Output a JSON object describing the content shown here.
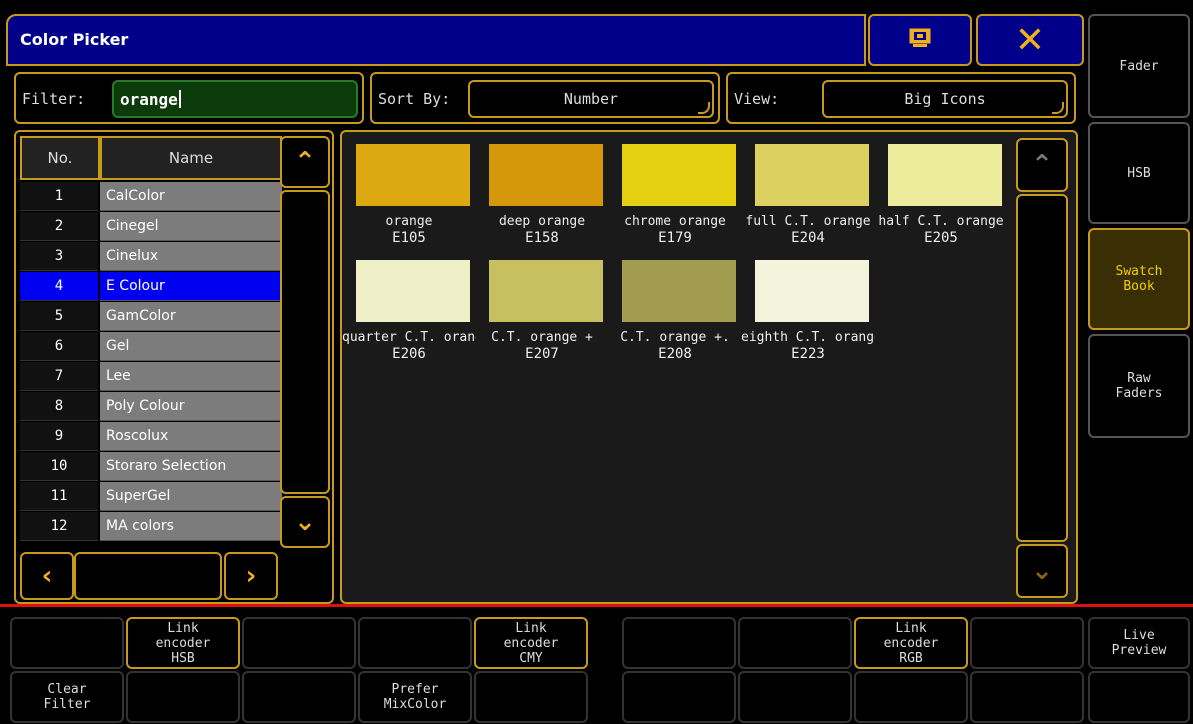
{
  "window": {
    "title": "Color Picker"
  },
  "header": {
    "screen_icon": "screen-icon",
    "close_icon": "close-icon"
  },
  "filter": {
    "label": "Filter:",
    "value": "orange"
  },
  "sort": {
    "label": "Sort By:",
    "value": "Number"
  },
  "view": {
    "label": "View:",
    "value": "Big Icons"
  },
  "list": {
    "headers": {
      "no": "No.",
      "name": "Name"
    },
    "rows": [
      {
        "no": "1",
        "name": "CalColor"
      },
      {
        "no": "2",
        "name": "Cinegel"
      },
      {
        "no": "3",
        "name": "Cinelux"
      },
      {
        "no": "4",
        "name": "E Colour",
        "selected": true
      },
      {
        "no": "5",
        "name": "GamColor"
      },
      {
        "no": "6",
        "name": "Gel"
      },
      {
        "no": "7",
        "name": "Lee"
      },
      {
        "no": "8",
        "name": "Poly Colour"
      },
      {
        "no": "9",
        "name": "Roscolux"
      },
      {
        "no": "10",
        "name": "Storaro Selection"
      },
      {
        "no": "11",
        "name": "SuperGel"
      },
      {
        "no": "12",
        "name": "MA colors"
      }
    ]
  },
  "swatches": [
    {
      "name": "orange",
      "code": "E105",
      "color": "#dcaa10"
    },
    {
      "name": "deep orange",
      "code": "E158",
      "color": "#d4980a"
    },
    {
      "name": "chrome orange",
      "code": "E179",
      "color": "#e4d010"
    },
    {
      "name": "full C.T. orange",
      "code": "E204",
      "color": "#dcd060"
    },
    {
      "name": "half C.T. orange",
      "code": "E205",
      "color": "#ecec9c"
    },
    {
      "name": "quarter C.T. orange",
      "code": "E206",
      "color": "#f0f0c8"
    },
    {
      "name": "C.T. orange + ",
      "code": "E207",
      "color": "#c8c060"
    },
    {
      "name": "C.T. orange +.",
      "code": "E208",
      "color": "#a29c50"
    },
    {
      "name": "eighth C.T. orange",
      "code": "E223",
      "color": "#f4f4dc"
    }
  ],
  "side": {
    "fader": "Fader",
    "hsb": "HSB",
    "swatch_book": "Swatch Book",
    "raw_faders": "Raw Faders"
  },
  "bottom": {
    "link_hsb": "Link encoder HSB",
    "link_cmy": "Link encoder CMY",
    "link_rgb": "Link encoder RGB",
    "live_preview": "Live Preview",
    "clear_filter": "Clear Filter",
    "prefer_mixcolor": "Prefer MixColor"
  },
  "colors": {
    "accent": "#c89a1c",
    "title_bg": "#00008b",
    "selected": "#0000f0",
    "alert": "#e01010"
  }
}
